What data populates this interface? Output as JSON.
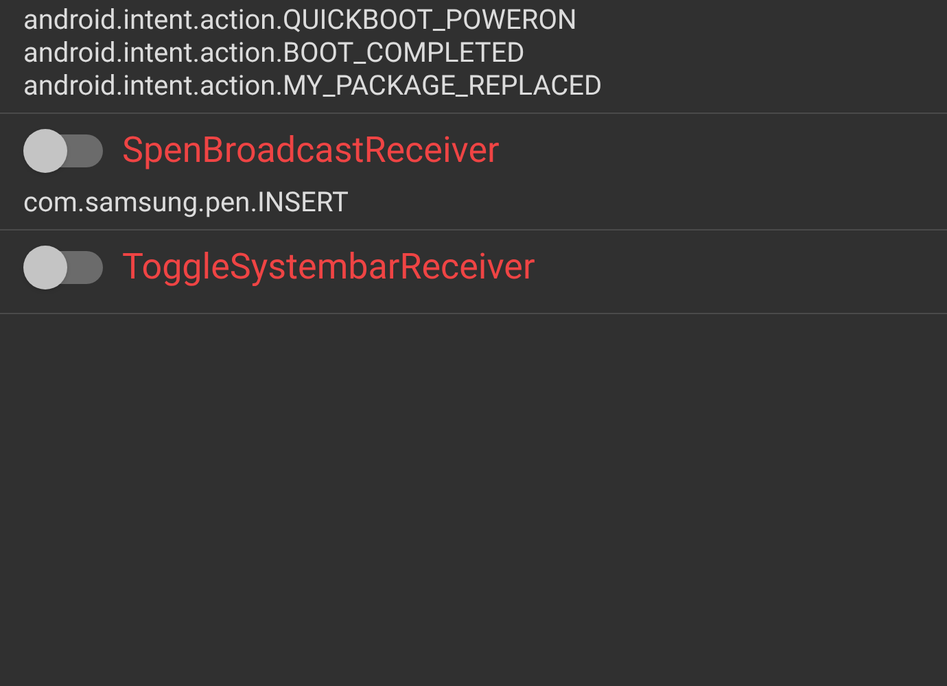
{
  "receivers": [
    {
      "actions": [
        "android.intent.action.QUICKBOOT_POWERON",
        "android.intent.action.BOOT_COMPLETED",
        "android.intent.action.MY_PACKAGE_REPLACED"
      ]
    },
    {
      "name": "SpenBroadcastReceiver",
      "on": false,
      "actions": [
        "com.samsung.pen.INSERT"
      ]
    },
    {
      "name": "ToggleSystembarReceiver",
      "on": false
    }
  ]
}
